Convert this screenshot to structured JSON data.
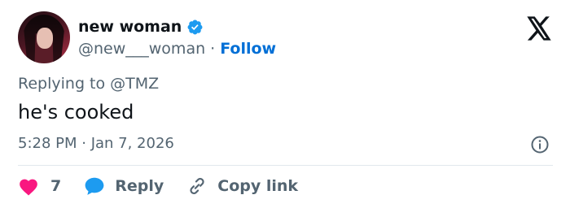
{
  "author": {
    "display_name": "new woman",
    "handle": "@new___woman",
    "separator": "·",
    "follow_label": "Follow",
    "verified": true
  },
  "tweet": {
    "replying_prefix": "Replying to",
    "replying_to": "@TMZ",
    "text": "he's cooked",
    "timestamp": "5:28 PM · Jan 7, 2026"
  },
  "actions": {
    "like_count": "7",
    "reply_label": "Reply",
    "copy_link_label": "Copy link"
  },
  "icons": {
    "logo": "x-logo-icon",
    "verified": "verified-badge-icon",
    "info": "info-icon",
    "like": "heart-icon",
    "reply": "reply-bubble-icon",
    "copy": "link-icon"
  },
  "colors": {
    "accent": "#1d9bf0",
    "follow": "#006fd6",
    "heart": "#f91880",
    "secondary_text": "#536471",
    "primary_text": "#0f1419"
  }
}
